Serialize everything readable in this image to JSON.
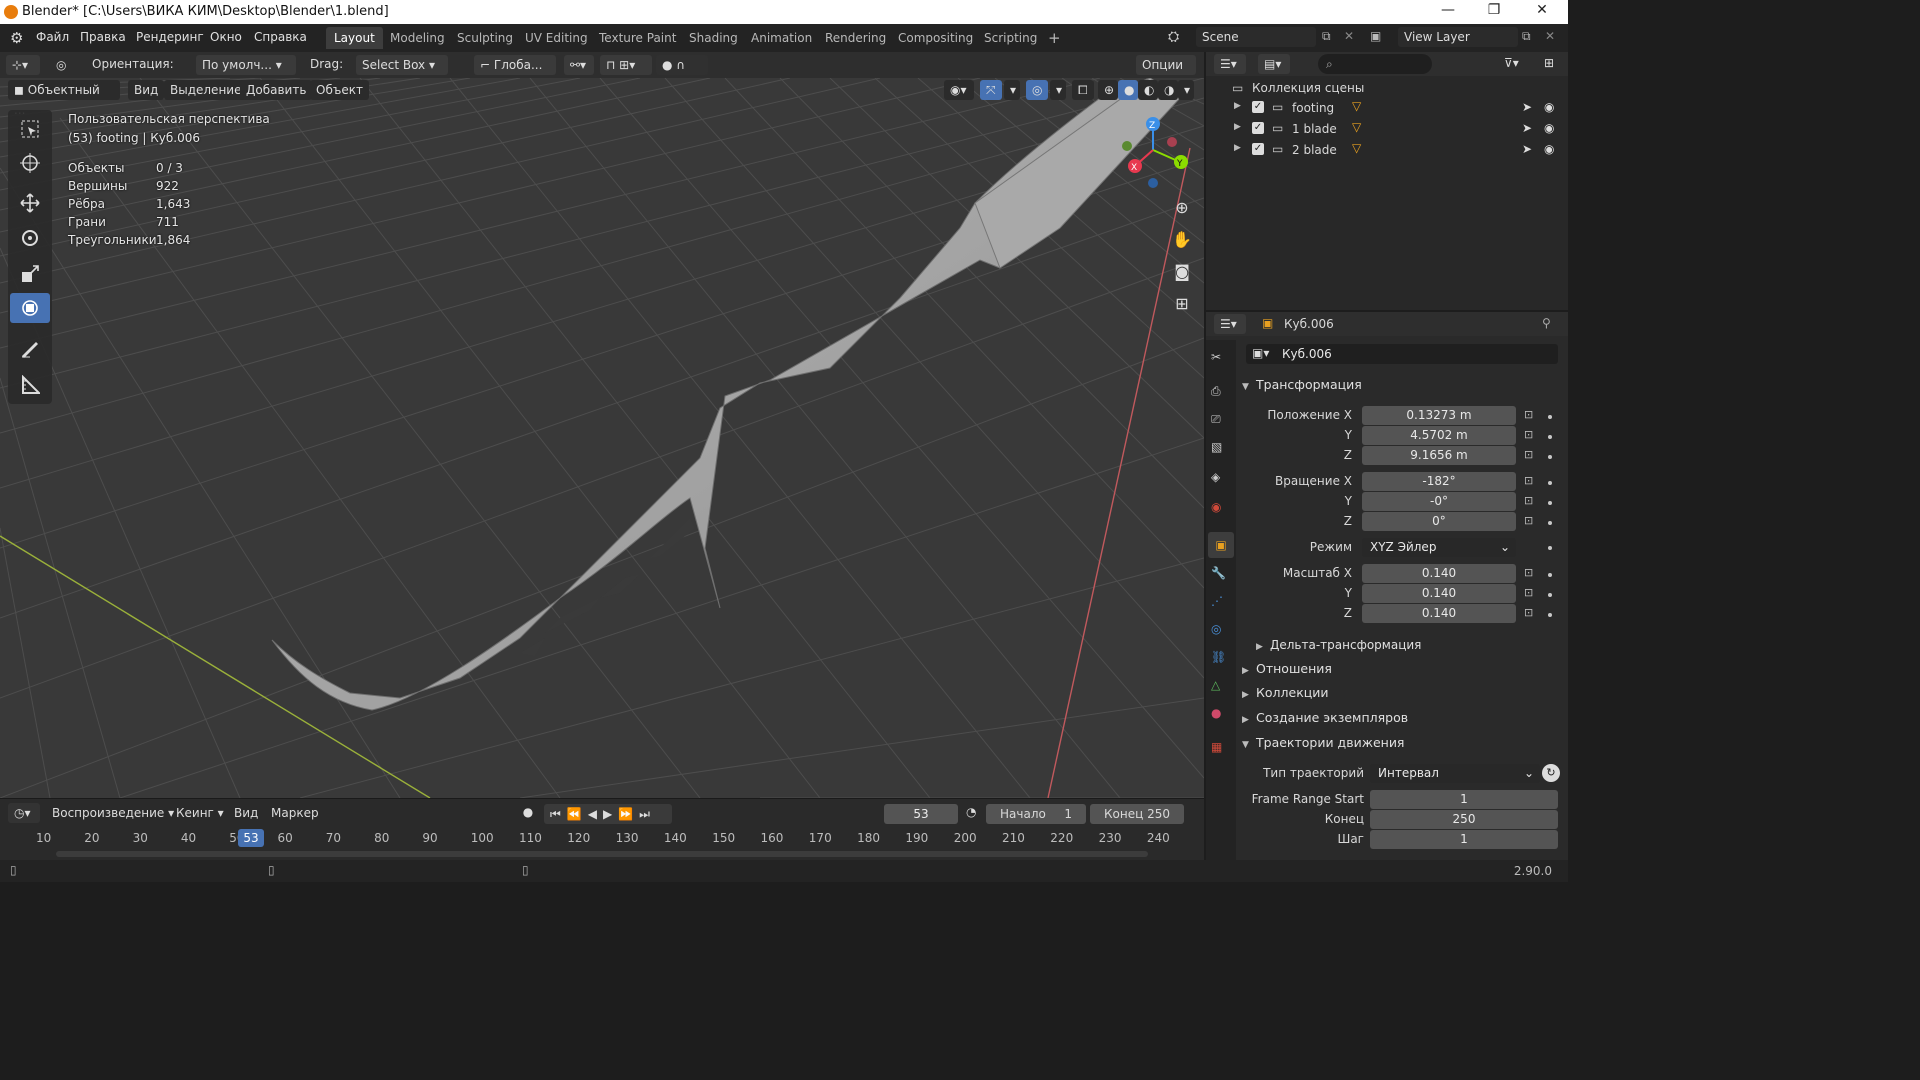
{
  "window": {
    "title": "Blender* [C:\\Users\\ВИКА КИМ\\Desktop\\Blender\\1.blend]",
    "minimize": "—",
    "maximize": "❐",
    "close": "✕"
  },
  "menubar": {
    "items": [
      "Файл",
      "Правка",
      "Рендеринг",
      "Окно",
      "Справка"
    ],
    "workspaces": [
      "Layout",
      "Modeling",
      "Sculpting",
      "UV Editing",
      "Texture Paint",
      "Shading",
      "Animation",
      "Rendering",
      "Compositing",
      "Scripting"
    ],
    "active_workspace": "Layout",
    "add_tab": "+",
    "scene": "Scene",
    "view_layer": "View Layer"
  },
  "viewport_header": {
    "orientation_label": "Ориентация:",
    "orientation_value": "По умолч...",
    "drag_label": "Drag:",
    "drag_value": "Select Box",
    "pivot_value": "Глоба...",
    "options": "Опции",
    "mode": "Объектный ...",
    "menus": [
      "Вид",
      "Выделение",
      "Добавить",
      "Объект"
    ]
  },
  "viewport_overlay": {
    "perspective": "Пользовательская перспектива",
    "object_info": "(53) footing | Куб.006",
    "stats": [
      {
        "label": "Объекты",
        "value": "0 / 3"
      },
      {
        "label": "Вершины",
        "value": "922"
      },
      {
        "label": "Рёбра",
        "value": "1,643"
      },
      {
        "label": "Грани",
        "value": "711"
      },
      {
        "label": "Треугольники",
        "value": "1,864"
      }
    ],
    "gizmo_axes": {
      "x": "X",
      "y": "Y",
      "z": "Z"
    }
  },
  "outliner": {
    "root": "Коллекция сцены",
    "collections": [
      "footing",
      "1 blade",
      "2 blade"
    ]
  },
  "properties": {
    "object_name": "Куб.006",
    "object_field": "Куб.006",
    "transform_title": "Трансформация",
    "location_label": "Положение X",
    "location": [
      "0.13273 m",
      "4.5702 m",
      "9.1656 m"
    ],
    "rotation_label": "Вращение X",
    "rotation": [
      "-182°",
      "-0°",
      "0°"
    ],
    "mode_label": "Режим",
    "mode_value": "XYZ Эйлер",
    "scale_label": "Масштаб X",
    "scale": [
      "0.140",
      "0.140",
      "0.140"
    ],
    "axis_y": "Y",
    "axis_z": "Z",
    "delta": "Дельта-трансформация",
    "panels": [
      "Отношения",
      "Коллекции",
      "Создание экземпляров"
    ],
    "motion_paths": "Траектории движения",
    "path_type_label": "Тип траекторий",
    "path_type_value": "Интервал",
    "frame_range_start_label": "Frame Range Start",
    "frame_range_start": "1",
    "end_label": "Конец",
    "end": "250",
    "step_label": "Шаг",
    "step": "1"
  },
  "timeline": {
    "menus": [
      "Воспроизведение",
      "Кеинг",
      "Вид",
      "Маркер"
    ],
    "current_frame": "53",
    "start_label": "Начало",
    "start": "1",
    "end_label": "Конец",
    "end": "250",
    "ticks": [
      "10",
      "20",
      "30",
      "40",
      "50",
      "60",
      "70",
      "80",
      "90",
      "100",
      "110",
      "120",
      "130",
      "140",
      "150",
      "160",
      "170",
      "180",
      "190",
      "200",
      "210",
      "220",
      "230",
      "240"
    ]
  },
  "statusbar": {
    "version": "2.90.0"
  },
  "colors": {
    "accent": "#4772b3",
    "axis_x": "#e8394f",
    "axis_y": "#8bdc00",
    "axis_z": "#3a8fe8",
    "object_orange": "#e8a020"
  }
}
